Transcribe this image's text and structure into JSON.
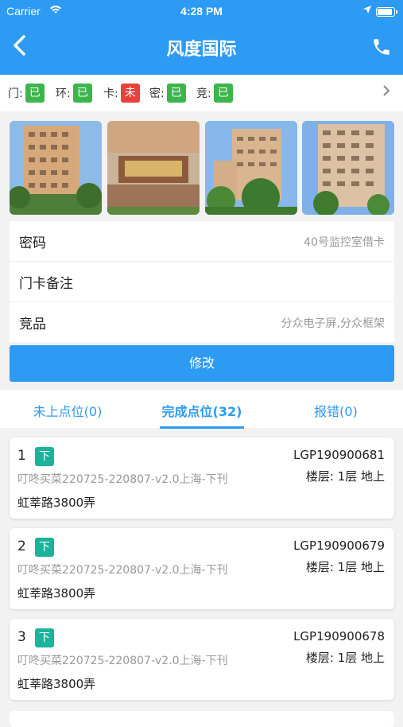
{
  "status_bar": {
    "carrier": "Carrier",
    "time": "4:28 PM"
  },
  "nav": {
    "title": "风度国际"
  },
  "status_row": [
    {
      "label": "门:",
      "value": "已",
      "color": "#3cb64a"
    },
    {
      "label": "环:",
      "value": "已",
      "color": "#3cb64a"
    },
    {
      "label": "卡:",
      "value": "未",
      "color": "#e8413c"
    },
    {
      "label": "密:",
      "value": "已",
      "color": "#3cb64a"
    },
    {
      "label": "竞:",
      "value": "已",
      "color": "#3cb64a"
    }
  ],
  "info": {
    "password_label": "密码",
    "password_value": "40号监控室借卡",
    "card_note_label": "门卡备注",
    "card_note_value": "",
    "competitor_label": "竞品",
    "competitor_value": "分众电子屏,分众框架"
  },
  "edit_button": "修改",
  "tabs": [
    {
      "label": "未上点位(0)"
    },
    {
      "label": "完成点位(32)"
    },
    {
      "label": "报错(0)"
    }
  ],
  "cards": [
    {
      "index": "1",
      "tag": "下",
      "code": "LGP190900681",
      "campaign": "叮咚买菜220725-220807-v2.0上海-下刊",
      "floor": "楼层: 1层 地上",
      "address": "虹莘路3800弄"
    },
    {
      "index": "2",
      "tag": "下",
      "code": "LGP190900679",
      "campaign": "叮咚买菜220725-220807-v2.0上海-下刊",
      "floor": "楼层: 1层 地上",
      "address": "虹莘路3800弄"
    },
    {
      "index": "3",
      "tag": "下",
      "code": "LGP190900678",
      "campaign": "叮咚买菜220725-220807-v2.0上海-下刊",
      "floor": "楼层: 1层 地上",
      "address": "虹莘路3800弄"
    }
  ],
  "colors": {
    "primary": "#2d9af3",
    "tag": "#1ab49a"
  }
}
